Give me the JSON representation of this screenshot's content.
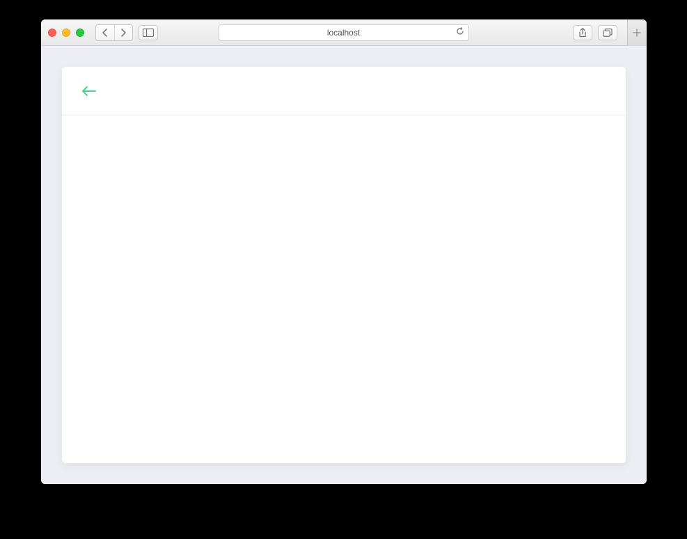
{
  "browser": {
    "address": "localhost"
  },
  "colors": {
    "accent_green": "#4cd38a",
    "page_bg": "#eceef4"
  }
}
